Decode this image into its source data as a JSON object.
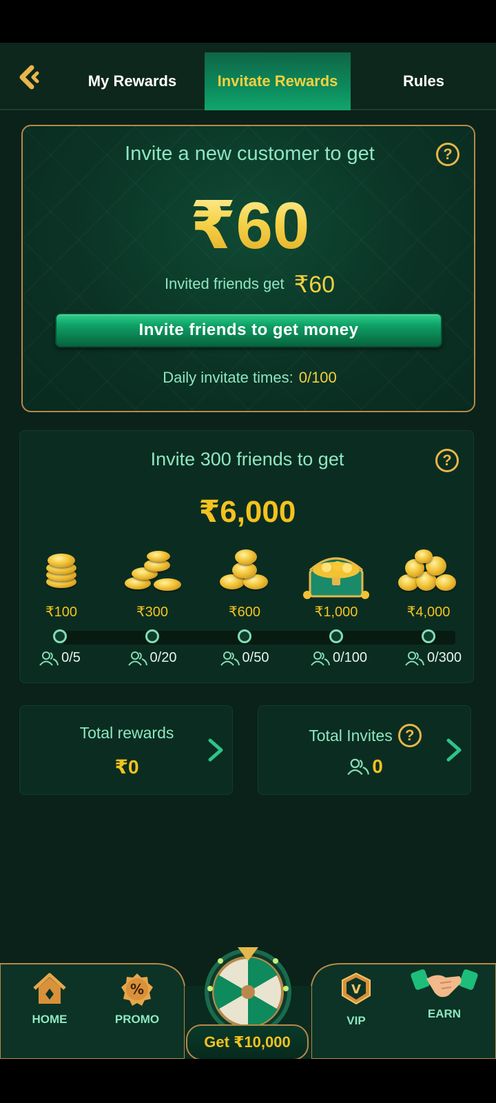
{
  "header": {
    "tabs": [
      {
        "label": "My Rewards"
      },
      {
        "label": "Invitate Rewards"
      },
      {
        "label": "Rules"
      }
    ]
  },
  "invite_card": {
    "title": "Invite a new customer to get",
    "amount": "₹60",
    "friends_get_label": "Invited friends get",
    "friends_get_amount": "₹60",
    "button_label": "Invite friends to get money",
    "daily_label": "Daily invitate times:",
    "daily_value": "0/100"
  },
  "milestone_card": {
    "title": "Invite 300 friends to get",
    "amount": "₹6,000",
    "milestones": [
      {
        "reward": "₹100",
        "progress": "0/5"
      },
      {
        "reward": "₹300",
        "progress": "0/20"
      },
      {
        "reward": "₹600",
        "progress": "0/50"
      },
      {
        "reward": "₹1,000",
        "progress": "0/100"
      },
      {
        "reward": "₹4,000",
        "progress": "0/300"
      }
    ]
  },
  "totals": {
    "rewards_label": "Total rewards",
    "rewards_value": "₹0",
    "invites_label": "Total Invites",
    "invites_value": "0"
  },
  "nav": {
    "home": "HOME",
    "promo": "PROMO",
    "get": "Get ₹10,000",
    "vip": "VIP",
    "earn": "EARN"
  },
  "colors": {
    "background": "#0a2219",
    "accent_green": "#8ee6c2",
    "gold": "#f4c21f",
    "border_gold": "#b8894a"
  },
  "icons": [
    "back-arrow-icon",
    "help-icon",
    "coin-stack-icon",
    "treasure-chest-icon",
    "users-icon",
    "chevron-right-icon",
    "home-icon",
    "promo-percent-icon",
    "lucky-wheel-icon",
    "vip-badge-icon",
    "handshake-icon"
  ]
}
